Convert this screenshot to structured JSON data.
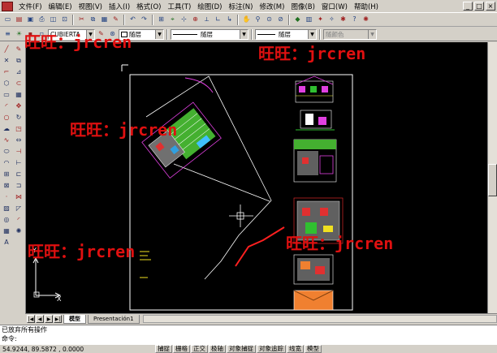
{
  "menu": {
    "items": [
      "文件(F)",
      "编辑(E)",
      "视图(V)",
      "插入(I)",
      "格式(O)",
      "工具(T)",
      "绘图(D)",
      "标注(N)",
      "修改(M)",
      "图像(B)",
      "窗口(W)",
      "帮助(H)"
    ]
  },
  "window_buttons": [
    "_",
    "□",
    "×"
  ],
  "toolbar2": {
    "layer_value": "CUBIERTA",
    "color_value": "随层",
    "linetype_value": "随层",
    "lineweight_value": "随层",
    "plotstyle_value": "随颜色"
  },
  "tabs": [
    "模型",
    "Presentación1"
  ],
  "active_tab": 0,
  "command": {
    "history_line": "已放弃所有操作",
    "prompt": "命令:"
  },
  "status": {
    "coordinates": "54.9244, 89.5872 , 0.0000",
    "buttons": [
      "捕捉",
      "栅格",
      "正交",
      "极轴",
      "对象捕捉",
      "对象追踪",
      "线宽",
      "模型"
    ]
  },
  "ucs": {
    "x_label": "X",
    "y_label": "Y"
  },
  "watermarks": [
    {
      "text": "旺旺：jrcren"
    },
    {
      "text": "旺旺：jrcren"
    },
    {
      "text": "旺旺：jrcren"
    },
    {
      "text": "旺旺：jrcren"
    },
    {
      "text": "旺旺：jrcren"
    }
  ],
  "colors": {
    "watermark": "#e01010",
    "canvas": "#000000",
    "chrome": "#d4d0c8"
  }
}
